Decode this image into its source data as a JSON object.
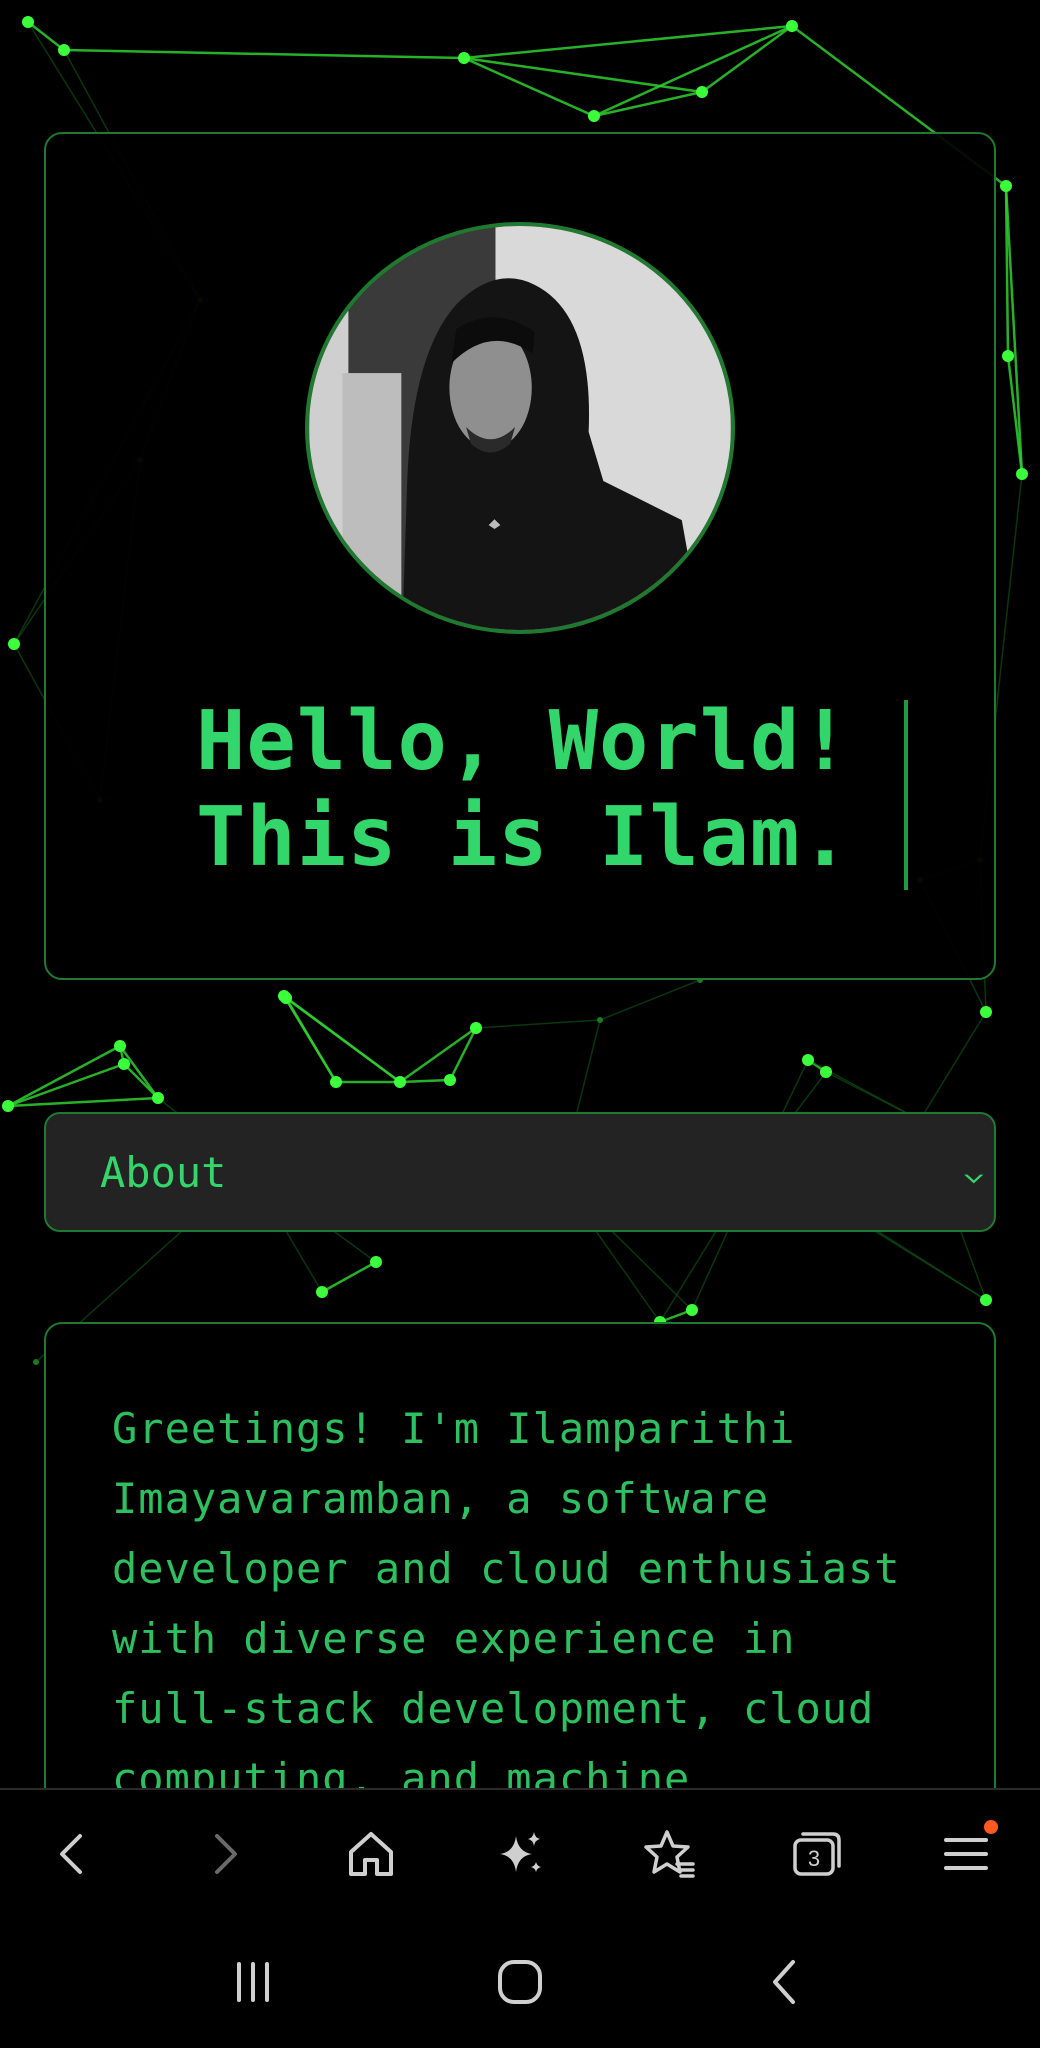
{
  "hero": {
    "greeting_line1": "Hello, World!",
    "greeting_line2": "This is Ilam."
  },
  "about": {
    "section_label": "About",
    "text_lines": [
      "Greetings! I'm Ilamparithi",
      "Imayavaramban, a software",
      "developer and cloud enthusiast",
      "with diverse experience in",
      "full-stack development, cloud",
      "computing, and machine"
    ]
  },
  "browser_toolbar": {
    "tabs_count": "3",
    "icons": [
      "back-icon",
      "forward-icon",
      "home-icon",
      "ai-sparkle-icon",
      "bookmarks-icon",
      "tabs-icon",
      "menu-icon"
    ]
  },
  "system_nav": {
    "icons": [
      "recents-icon",
      "home-circle-icon",
      "system-back-icon"
    ]
  },
  "colors": {
    "background": "#000000",
    "accent_green": "#33d66a",
    "border_green": "#1f7a2f",
    "notification_dot": "#ff5a1f"
  }
}
